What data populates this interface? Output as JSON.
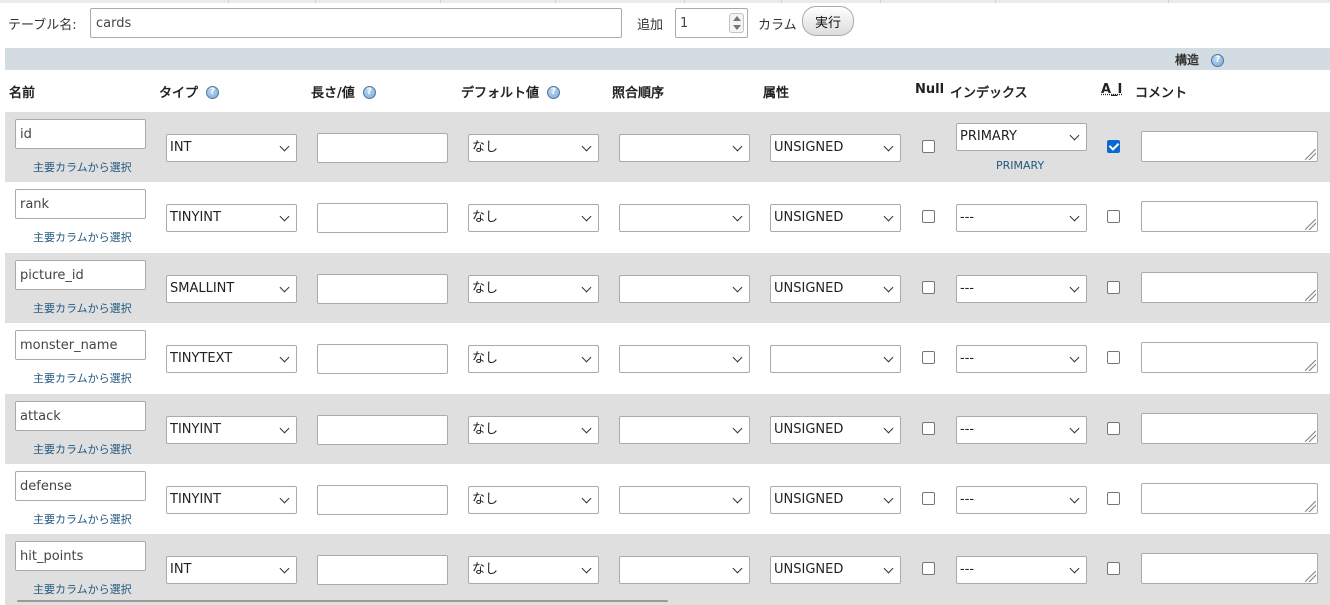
{
  "toolbar": {
    "table_name_label": "テーブル名:",
    "table_name_value": "cards",
    "add_label": "追加",
    "add_count": "1",
    "columns_label": "カラム",
    "go_button": "実行"
  },
  "structure_label": "構造",
  "headers": {
    "name": "名前",
    "type": "タイプ",
    "length": "長さ/値",
    "default": "デフォルト値",
    "collation": "照合順序",
    "attributes": "属性",
    "null": "Null",
    "index": "インデックス",
    "ai": "A_I",
    "comment": "コメント"
  },
  "pick_link": "主要カラムから選択",
  "rows": [
    {
      "name": "id",
      "type": "INT",
      "default": "なし",
      "collation": "",
      "attribute": "UNSIGNED",
      "null": false,
      "index": "PRIMARY",
      "index_link": "PRIMARY",
      "ai": true
    },
    {
      "name": "rank",
      "type": "TINYINT",
      "default": "なし",
      "collation": "",
      "attribute": "UNSIGNED",
      "null": false,
      "index": "---",
      "index_link": "",
      "ai": false
    },
    {
      "name": "picture_id",
      "type": "SMALLINT",
      "default": "なし",
      "collation": "",
      "attribute": "UNSIGNED",
      "null": false,
      "index": "---",
      "index_link": "",
      "ai": false
    },
    {
      "name": "monster_name",
      "type": "TINYTEXT",
      "default": "なし",
      "collation": "",
      "attribute": "",
      "null": false,
      "index": "---",
      "index_link": "",
      "ai": false
    },
    {
      "name": "attack",
      "type": "TINYINT",
      "default": "なし",
      "collation": "",
      "attribute": "UNSIGNED",
      "null": false,
      "index": "---",
      "index_link": "",
      "ai": false
    },
    {
      "name": "defense",
      "type": "TINYINT",
      "default": "なし",
      "collation": "",
      "attribute": "UNSIGNED",
      "null": false,
      "index": "---",
      "index_link": "",
      "ai": false
    },
    {
      "name": "hit_points",
      "type": "INT",
      "default": "なし",
      "collation": "",
      "attribute": "UNSIGNED",
      "null": false,
      "index": "---",
      "index_link": "",
      "ai": false
    }
  ],
  "icons": {
    "help": "help-icon",
    "dropdown": "chevron-down-icon",
    "resize": "resize-grip-icon"
  },
  "colors": {
    "header_bar": "#d3dce3",
    "row_alt": "#dfdfdf",
    "link": "#235a81",
    "checkbox_checked": "#0a68d2"
  }
}
